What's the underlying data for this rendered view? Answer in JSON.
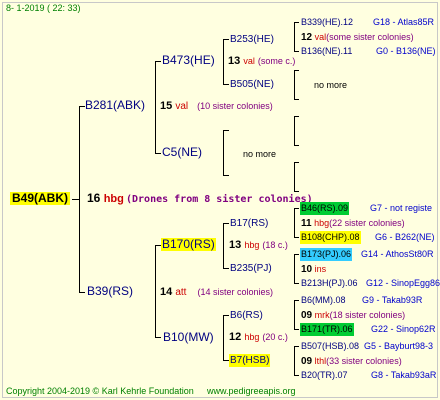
{
  "header": {
    "date": "8-  1-2019 ( 22: 33)"
  },
  "root": {
    "label": "B49(ABK)",
    "gen_number": "16",
    "gen_code": "hbg",
    "note": "(Drones from 8 sister colonies)"
  },
  "father": {
    "label": "B281(ABK)",
    "num": "15",
    "code": "val",
    "sisters": "(10 sister colonies)"
  },
  "father_father": {
    "label": "B473(HE)",
    "num": "13",
    "code": "val",
    "sisters": "(some c.)"
  },
  "father_mother": {
    "label": "C5(NE)",
    "no_more": "no more"
  },
  "ff_father": {
    "label": "B253(HE)"
  },
  "ff_mother": {
    "label": "B505(NE)",
    "no_more": "no more"
  },
  "fff_top": {
    "label": "B339(HE).12",
    "info": "G18 - Atlas85R"
  },
  "fff_mid": {
    "num": "12",
    "code": "val",
    "sisters": "(some sister colonies)"
  },
  "fff_bot": {
    "label": "B136(NE).11",
    "info": "G0 - B136(NE)"
  },
  "mother": {
    "label": "B39(RS)",
    "num": "14",
    "code": "att",
    "sisters": "(14 sister colonies)"
  },
  "mother_father": {
    "label": "B170(RS)",
    "num": "13",
    "code": "hbg",
    "sisters": "(18 c.)"
  },
  "mother_mother": {
    "label": "B10(MW)",
    "num": "12",
    "code": "hbg",
    "sisters": "(20 c.)"
  },
  "mf_father": {
    "label": "B17(RS)"
  },
  "mf_mother": {
    "label": "B235(PJ)"
  },
  "mm_father": {
    "label": "B6(RS)"
  },
  "mm_mother": {
    "label": "B7(HSB)"
  },
  "mff_top": {
    "label": "B46(RS).09",
    "info": "G7 - not registe"
  },
  "mff_mid": {
    "num": "11",
    "code": "hbg",
    "sisters": "(22 sister colonies)"
  },
  "mff_bot": {
    "label": "B108(CHP).08",
    "info": "G6 - B262(NE)"
  },
  "mfm_top": {
    "label": "B173(PJ).06",
    "info": "G14 - AthosSt80R"
  },
  "mfm_mid": {
    "num": "10",
    "code": "ins"
  },
  "mfm_bot": {
    "label": "B213H(PJ).06",
    "info": "G12 - SinopEgg86R"
  },
  "mmf_top": {
    "label": "B6(MM).08",
    "info": "G9 - Takab93R"
  },
  "mmf_mid": {
    "num": "09",
    "code": "mrk",
    "sisters": "(18 sister colonies)"
  },
  "mmf_bot": {
    "label": "B171(TR).06",
    "info": "G22 - Sinop62R"
  },
  "mmm_top": {
    "label": "B507(HSB).08",
    "info": "G5 - Bayburt98-3"
  },
  "mmm_mid": {
    "num": "09",
    "code": "lthl",
    "sisters": "(33 sister colonies)"
  },
  "mmm_bot": {
    "label": "B20(TR).07",
    "info": "G8 - Takab93aR"
  },
  "footer": {
    "copyright": "Copyright 2004-2019 © Karl Kehrle Foundation",
    "site": "www.pedigreeapis.org"
  }
}
